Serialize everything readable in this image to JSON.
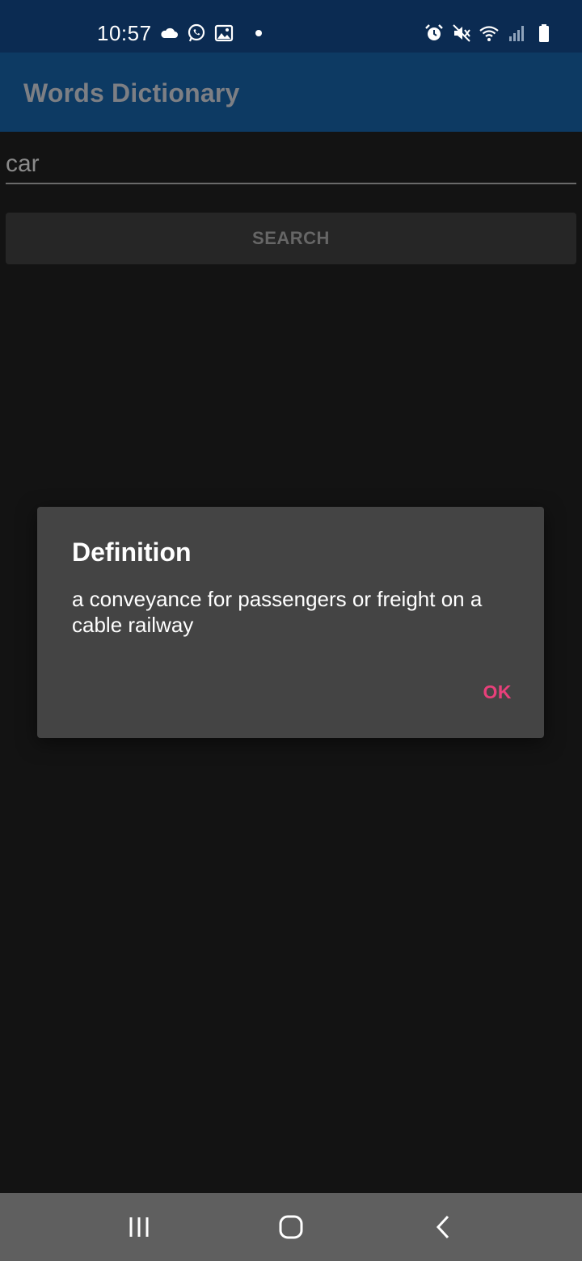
{
  "status_bar": {
    "time": "10:57",
    "left_icons": [
      "cloud-icon",
      "whatsapp-icon",
      "image-icon",
      "notification-dot-icon"
    ],
    "right_icons": [
      "alarm-icon",
      "mute-icon",
      "wifi-icon",
      "signal-icon",
      "battery-icon"
    ]
  },
  "app_bar": {
    "title": "Words Dictionary"
  },
  "search": {
    "value": "car",
    "button_label": "SEARCH"
  },
  "dialog": {
    "title": "Definition",
    "message": "a conveyance for passengers or freight on a cable railway",
    "ok_label": "OK"
  },
  "nav_bar": {
    "icons": [
      "recent-apps-icon",
      "home-icon",
      "back-icon"
    ]
  },
  "colors": {
    "status_bar_bg": "#0b2b52",
    "app_bar_bg": "#0d3a63",
    "background": "#131313",
    "dialog_bg": "#444444",
    "accent": "#e8407a",
    "nav_bar_bg": "#5f5f5f"
  }
}
